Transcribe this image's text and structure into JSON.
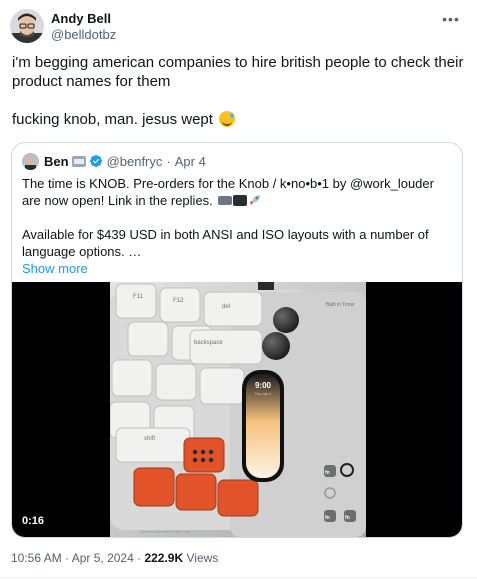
{
  "author": {
    "name": "Andy Bell",
    "handle": "@belldotbz"
  },
  "tweet": {
    "line1": "i'm begging american companies to hire british people to check their product names for them",
    "line2": "fucking knob, man. jesus wept",
    "emoji": "sweat-smile-emoji"
  },
  "quoted": {
    "name": "Ben",
    "handle": "@benfryc",
    "separator": "·",
    "date": "Apr 4",
    "para1": "The time is KNOB. Pre-orders for the Knob / k•no•b•1 by @work_louder are now open! Link in the replies.",
    "para2": "Available for $439 USD in both ANSI and ISO layouts with a number of language options. …",
    "show_more": "Show more",
    "video": {
      "duration": "0:16",
      "screen_time": "9:00",
      "screen_date": "Thu, Apr 4",
      "corner_label": "Built in Timer",
      "keys": {
        "f11": "F11",
        "f12": "F12",
        "del": "del",
        "backspace": "backspace",
        "shift": "shift",
        "fn": "fn"
      },
      "caption": "Screen animations Not Final"
    }
  },
  "meta": {
    "time": "10:56 AM",
    "sep1": "·",
    "date": "Apr 5, 2024",
    "sep2": "·",
    "views": "222.9K",
    "views_label": "Views"
  },
  "colors": {
    "link": "#1d9bf0",
    "secondary_text": "#536471",
    "border": "#cfd9de",
    "key_orange": "#e2532a"
  }
}
